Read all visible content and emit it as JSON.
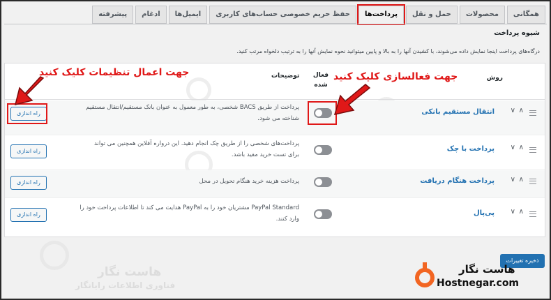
{
  "tabs": [
    {
      "label": "همگانی",
      "active": false
    },
    {
      "label": "محصولات",
      "active": false
    },
    {
      "label": "حمل و نقل",
      "active": false
    },
    {
      "label": "پرداخت‌ها",
      "active": true
    },
    {
      "label": "حفظ حریم خصوصی حساب‌های کاربری",
      "active": false
    },
    {
      "label": "ایمیل‌ها",
      "active": false
    },
    {
      "label": "ادغام",
      "active": false
    },
    {
      "label": "پیشرفته",
      "active": false
    }
  ],
  "section": {
    "title": "شیوه پرداخت",
    "description": "درگاه‌های پرداخت اینجا نمایش داده می‌شوند، با کشیدن آنها را به بالا و پایین میتوانید نحوه نمایش آنها را به ترتیب دلخواه مرتب کنید."
  },
  "table_headers": {
    "method": "روش",
    "enabled_line1": "فعال",
    "enabled_line2": "شده",
    "description": "توضیحات"
  },
  "gateways": [
    {
      "name": "انتقال مستقیم بانکی",
      "desc_line1": "پرداخت از طریق BACS شخصی، به طور معمول به عنوان بانک مستقیم/انتقال مستقیم",
      "desc_line2": "شناخته می شود.",
      "button": "راه اندازی"
    },
    {
      "name": "پرداخت با چک",
      "desc_line1": "پرداخت‌های شخصی را از طریق چک انجام دهید. این درواره آفلاین همچنین می تواند",
      "desc_line2": "برای تست خرید مفید باشد.",
      "button": "راه اندازی"
    },
    {
      "name": "پرداخت هنگام دریافت",
      "desc_line1": "پرداخت هزینه خرید هنگام تحویل در محل",
      "desc_line2": "",
      "button": "راه اندازی"
    },
    {
      "name": "پی‌پال",
      "desc_line1": "PayPal Standard مشتریان خود را به PayPal هدایت می کند تا اطلاعات پرداخت خود را",
      "desc_line2": "وارد کنند.",
      "button": "راه اندازی"
    }
  ],
  "save_button": "ذخیره تغییرات",
  "annotations": {
    "settings": "جهت اعمال تنظیمات کلیک کنید",
    "activate": "جهت فعالسازی کلیک کنید"
  },
  "watermark": {
    "title": "هاست نگار",
    "subtitle": "فناوری اطلاعات رایانگار"
  },
  "brand": {
    "name_fa": "هاست نگار",
    "domain": "Hostnegar.com",
    "color": "#f26522"
  },
  "colors": {
    "accent": "#2271b1",
    "highlight": "#e01818"
  }
}
